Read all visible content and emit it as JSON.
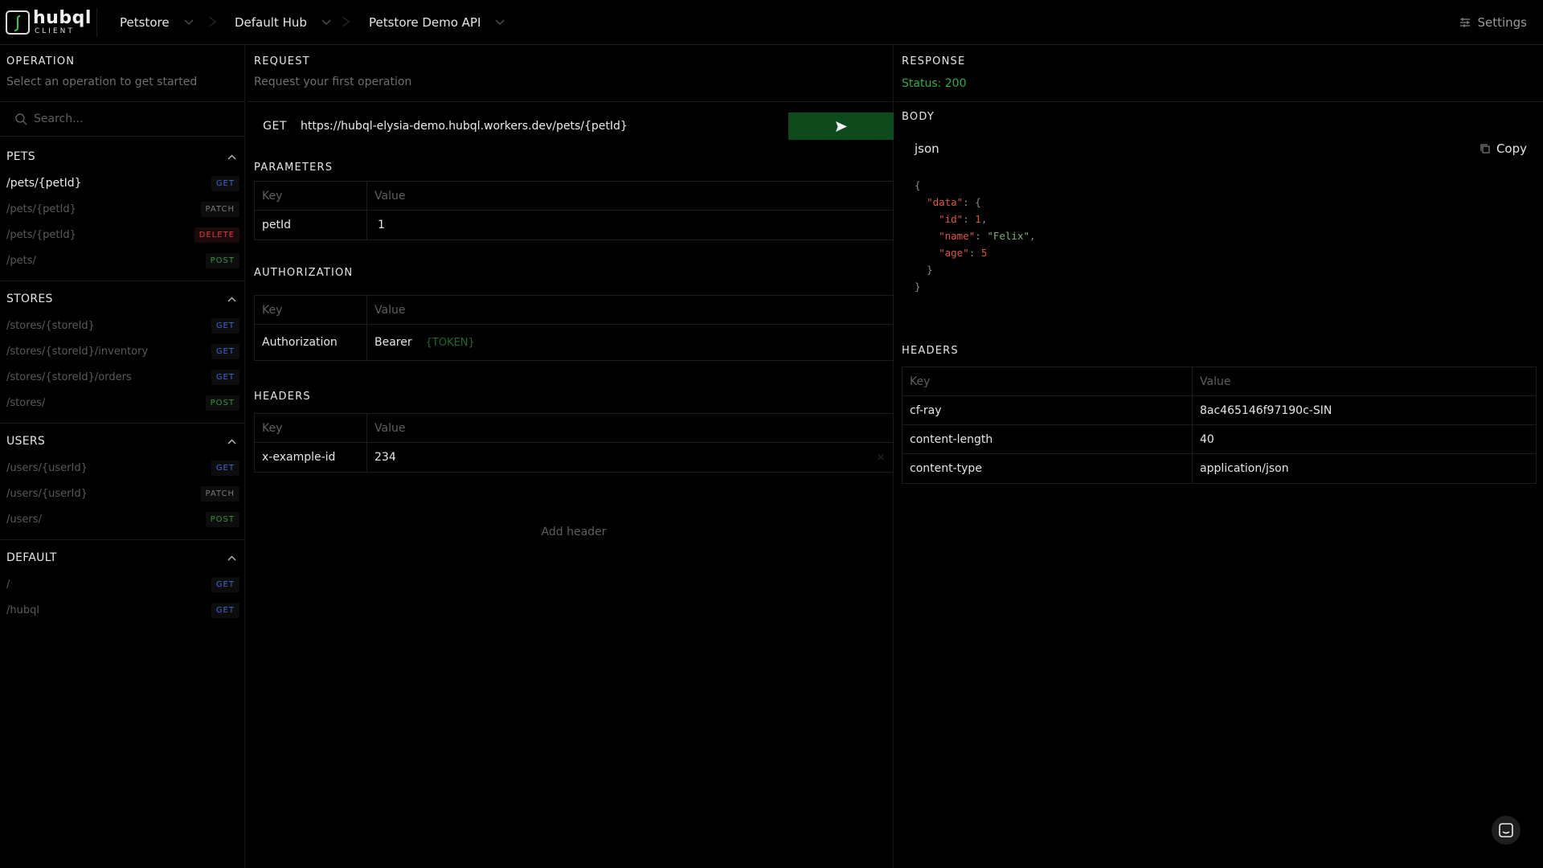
{
  "app": {
    "name": "hubql",
    "sub": "CLIENT"
  },
  "breadcrumbs": [
    {
      "label": "Petstore"
    },
    {
      "label": "Default Hub"
    },
    {
      "label": "Petstore Demo API"
    }
  ],
  "settings_label": "Settings",
  "sidebar": {
    "title": "OPERATION",
    "subtitle": "Select an operation to get started",
    "search_placeholder": "Search...",
    "groups": [
      {
        "name": "PETS",
        "routes": [
          {
            "path": "/pets/{petId}",
            "method": "GET"
          },
          {
            "path": "/pets/{petId}",
            "method": "PATCH"
          },
          {
            "path": "/pets/{petId}",
            "method": "DELETE"
          },
          {
            "path": "/pets/",
            "method": "POST"
          }
        ]
      },
      {
        "name": "STORES",
        "routes": [
          {
            "path": "/stores/{storeId}",
            "method": "GET"
          },
          {
            "path": "/stores/{storeId}/inventory",
            "method": "GET"
          },
          {
            "path": "/stores/{storeId}/orders",
            "method": "GET"
          },
          {
            "path": "/stores/",
            "method": "POST"
          }
        ]
      },
      {
        "name": "USERS",
        "routes": [
          {
            "path": "/users/{userId}",
            "method": "GET"
          },
          {
            "path": "/users/{userId}",
            "method": "PATCH"
          },
          {
            "path": "/users/",
            "method": "POST"
          }
        ]
      },
      {
        "name": "DEFAULT",
        "routes": [
          {
            "path": "/",
            "method": "GET"
          },
          {
            "path": "/hubql",
            "method": "GET"
          }
        ]
      }
    ]
  },
  "request": {
    "title": "REQUEST",
    "subtitle": "Request your first operation",
    "method": "GET",
    "url": "https://hubql-elysia-demo.hubql.workers.dev/pets/{petId}",
    "parameters_title": "PARAMETERS",
    "authorization_title": "AUTHORIZATION",
    "headers_title": "HEADERS",
    "col_key": "Key",
    "col_value": "Value",
    "params": [
      {
        "key": "petId",
        "value": "1"
      }
    ],
    "auth": {
      "key": "Authorization",
      "scheme": "Bearer",
      "token": "{TOKEN}"
    },
    "headers": [
      {
        "key": "x-example-id",
        "value": "234"
      }
    ],
    "add_header": "Add header"
  },
  "response": {
    "title": "RESPONSE",
    "status": "Status: 200",
    "body_title": "BODY",
    "lang": "json",
    "copy_label": "Copy",
    "body": {
      "punct_open": "{",
      "k_data": "\"data\"",
      "k_id": "\"id\"",
      "v_id": "1",
      "k_name": "\"name\"",
      "v_name": "\"Felix\"",
      "k_age": "\"age\"",
      "v_age": "5",
      "punct_close_inner": "}",
      "punct_close": "}"
    },
    "headers_title": "HEADERS",
    "col_key": "Key",
    "col_value": "Value",
    "headers": [
      {
        "key": "cf-ray",
        "value": "8ac465146f97190c-SIN"
      },
      {
        "key": "content-length",
        "value": "40"
      },
      {
        "key": "content-type",
        "value": "application/json"
      }
    ]
  }
}
